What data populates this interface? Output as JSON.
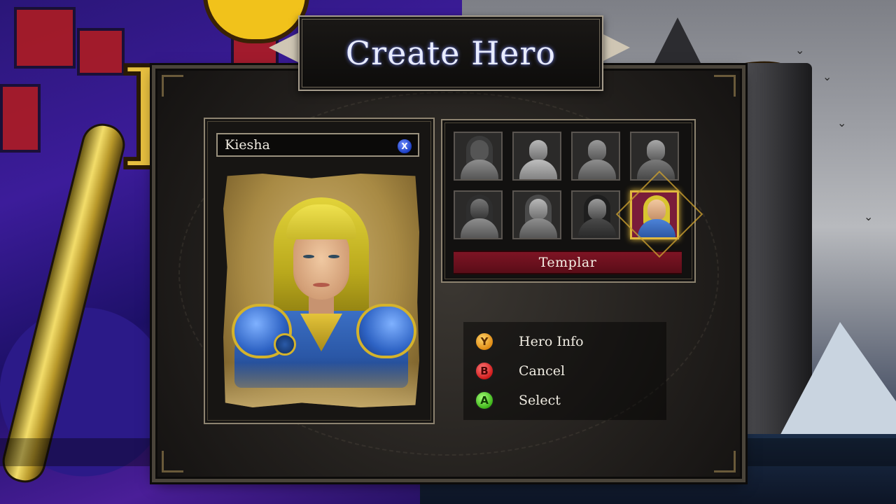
{
  "title": "Create Hero",
  "hero": {
    "name": "Kiesha",
    "rename_button": "X"
  },
  "class_select": {
    "selected_index": 7,
    "selected_class": "Templar",
    "portraits": [
      {
        "icon": "hooded-rogue-portrait-icon",
        "state": "greyed"
      },
      {
        "icon": "barbarian-portrait-icon",
        "state": "greyed"
      },
      {
        "icon": "warrior-portrait-icon",
        "state": "greyed"
      },
      {
        "icon": "bearded-knight-portrait-icon",
        "state": "greyed"
      },
      {
        "icon": "masked-assassin-portrait-icon",
        "state": "greyed"
      },
      {
        "icon": "ranger-woman-portrait-icon",
        "state": "greyed"
      },
      {
        "icon": "hooded-mage-portrait-icon",
        "state": "greyed"
      },
      {
        "icon": "templar-portrait-icon",
        "state": "selected"
      }
    ]
  },
  "prompts": [
    {
      "button": "Y",
      "label": "Hero Info",
      "color": "#e08b14"
    },
    {
      "button": "B",
      "label": "Cancel",
      "color": "#d01c1c"
    },
    {
      "button": "A",
      "label": "Select",
      "color": "#3fb51a"
    }
  ],
  "colors": {
    "accent_gold": "#e0b83e",
    "class_bar": "#7e1424",
    "title_glow": "#6f7dd8"
  }
}
